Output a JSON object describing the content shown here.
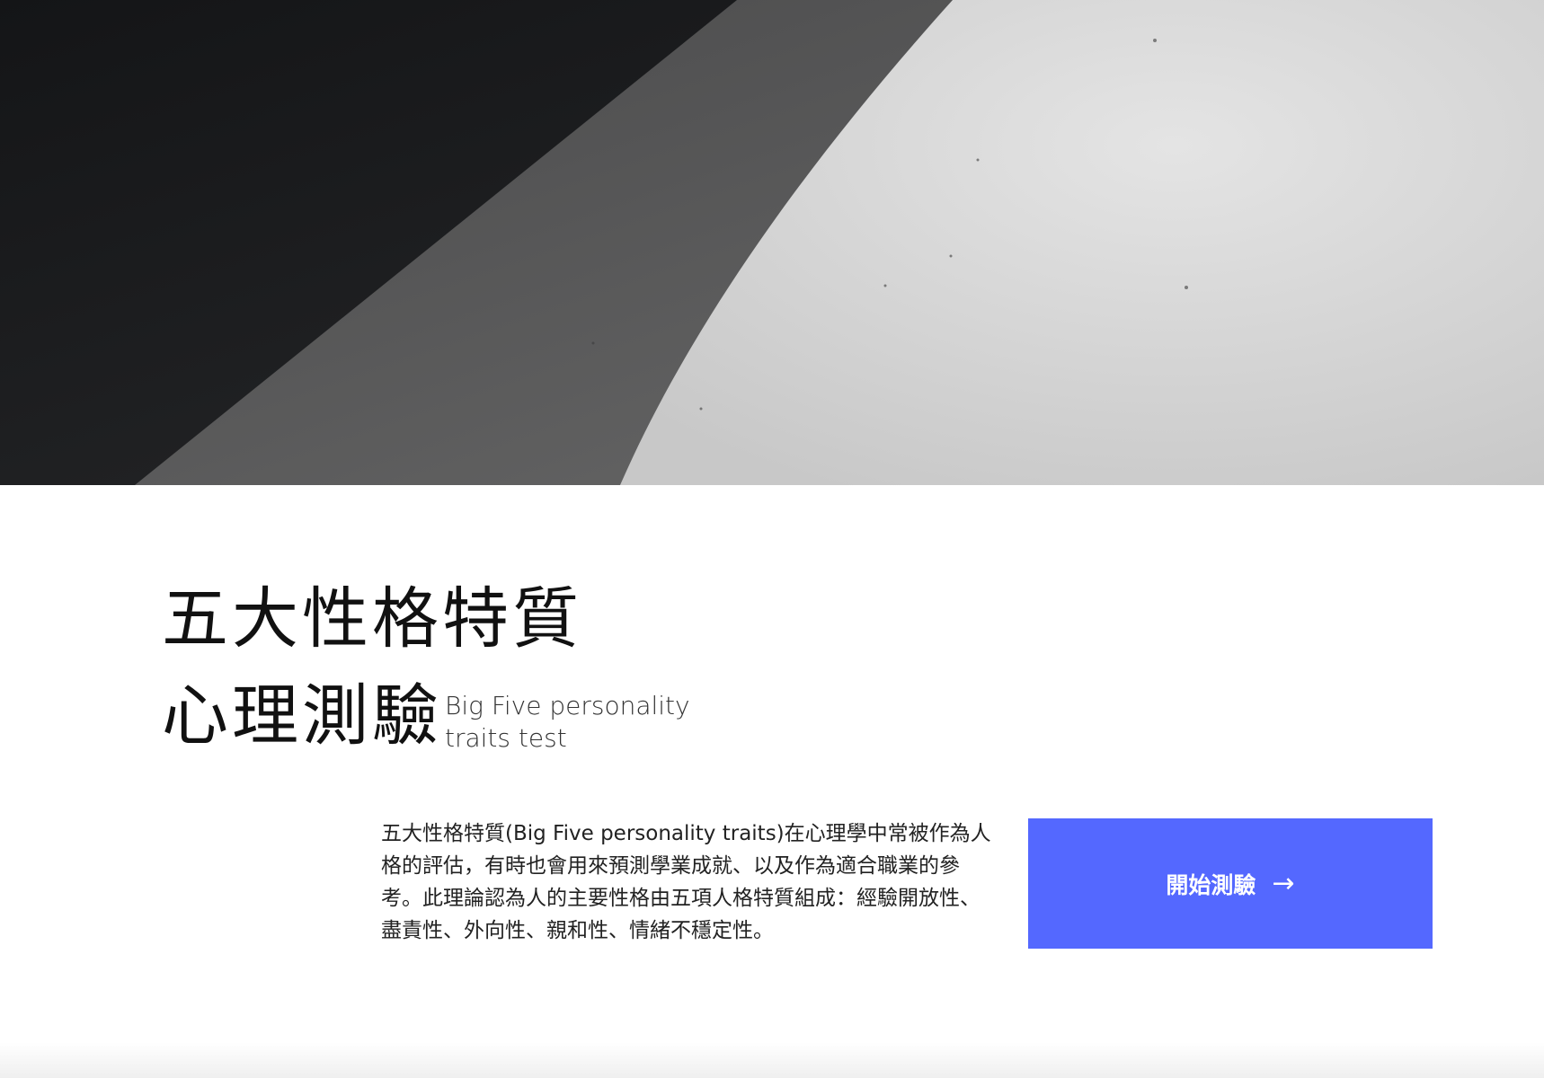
{
  "hero": {
    "image_alt": "abstract black and white architectural curve"
  },
  "title": {
    "main": "五大性格特質",
    "sub": "心理測驗",
    "english_line1": "Big Five personality",
    "english_line2": "traits test"
  },
  "description": "五大性格特質(Big Five personality traits)在心理學中常被作為人格的評估，有時也會用來預測學業成就、以及作為適合職業的參考。此理論認為人的主要性格由五項人格特質組成：經驗開放性、盡責性、外向性、親和性、情緒不穩定性。",
  "cta": {
    "label": "開始測驗",
    "arrow": "→",
    "color": "#5468ff"
  },
  "colors": {
    "hero_dark": "#1b1c1e",
    "hero_mid": "#5a5a5b",
    "hero_light": "#d6d6d6",
    "text": "#111111"
  }
}
